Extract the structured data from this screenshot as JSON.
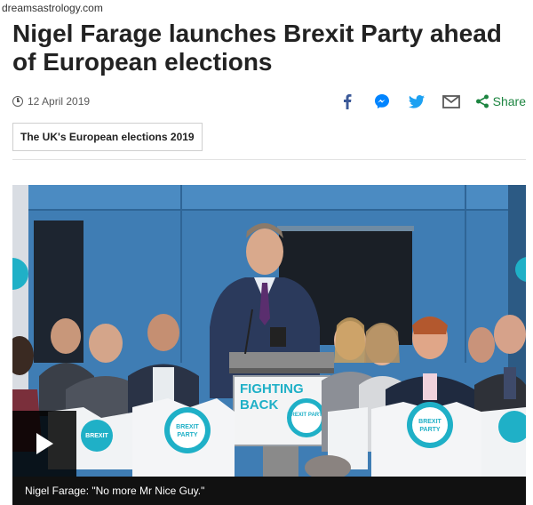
{
  "watermark": "dreamsastrology.com",
  "article": {
    "headline": "Nigel Farage launches Brexit Party ahead of European elections",
    "date": "12 April 2019",
    "topic_tag": "The UK's European elections 2019"
  },
  "share": {
    "icons": [
      "facebook-icon",
      "messenger-icon",
      "twitter-icon",
      "email-icon",
      "share-icon"
    ],
    "label": "Share",
    "colors": {
      "facebook": "#3b5998",
      "messenger": "#0084ff",
      "twitter": "#1da1f2",
      "email": "#5a5a5a",
      "share": "#1d8541"
    }
  },
  "media": {
    "caption": "Nigel Farage: \"No more Mr Nice Guy.\"",
    "podium_sign": {
      "line1": "FIGHTING",
      "line2": "BACK",
      "logo": "BREXIT PARTY"
    },
    "shirt_logo": {
      "line1": "BREXIT",
      "line2": "PARTY"
    },
    "colors": {
      "wall": "#3f7db4",
      "teal": "#1fb0c7",
      "podium": "#7c7c7c"
    }
  }
}
